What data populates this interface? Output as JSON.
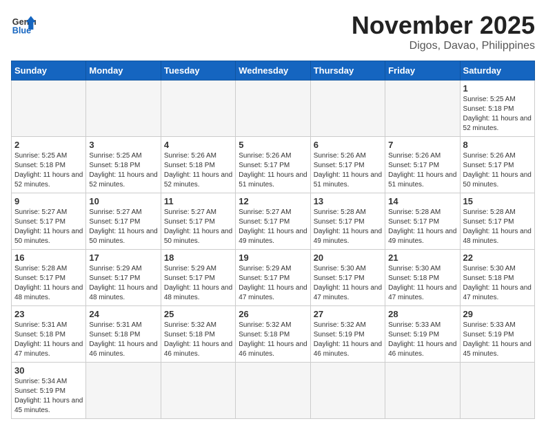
{
  "header": {
    "logo_general": "General",
    "logo_blue": "Blue",
    "title": "November 2025",
    "subtitle": "Digos, Davao, Philippines"
  },
  "weekdays": [
    "Sunday",
    "Monday",
    "Tuesday",
    "Wednesday",
    "Thursday",
    "Friday",
    "Saturday"
  ],
  "days": {
    "1": {
      "sunrise": "5:25 AM",
      "sunset": "5:18 PM",
      "daylight": "11 hours and 52 minutes."
    },
    "2": {
      "sunrise": "5:25 AM",
      "sunset": "5:18 PM",
      "daylight": "11 hours and 52 minutes."
    },
    "3": {
      "sunrise": "5:25 AM",
      "sunset": "5:18 PM",
      "daylight": "11 hours and 52 minutes."
    },
    "4": {
      "sunrise": "5:26 AM",
      "sunset": "5:18 PM",
      "daylight": "11 hours and 52 minutes."
    },
    "5": {
      "sunrise": "5:26 AM",
      "sunset": "5:17 PM",
      "daylight": "11 hours and 51 minutes."
    },
    "6": {
      "sunrise": "5:26 AM",
      "sunset": "5:17 PM",
      "daylight": "11 hours and 51 minutes."
    },
    "7": {
      "sunrise": "5:26 AM",
      "sunset": "5:17 PM",
      "daylight": "11 hours and 51 minutes."
    },
    "8": {
      "sunrise": "5:26 AM",
      "sunset": "5:17 PM",
      "daylight": "11 hours and 50 minutes."
    },
    "9": {
      "sunrise": "5:27 AM",
      "sunset": "5:17 PM",
      "daylight": "11 hours and 50 minutes."
    },
    "10": {
      "sunrise": "5:27 AM",
      "sunset": "5:17 PM",
      "daylight": "11 hours and 50 minutes."
    },
    "11": {
      "sunrise": "5:27 AM",
      "sunset": "5:17 PM",
      "daylight": "11 hours and 50 minutes."
    },
    "12": {
      "sunrise": "5:27 AM",
      "sunset": "5:17 PM",
      "daylight": "11 hours and 49 minutes."
    },
    "13": {
      "sunrise": "5:28 AM",
      "sunset": "5:17 PM",
      "daylight": "11 hours and 49 minutes."
    },
    "14": {
      "sunrise": "5:28 AM",
      "sunset": "5:17 PM",
      "daylight": "11 hours and 49 minutes."
    },
    "15": {
      "sunrise": "5:28 AM",
      "sunset": "5:17 PM",
      "daylight": "11 hours and 48 minutes."
    },
    "16": {
      "sunrise": "5:28 AM",
      "sunset": "5:17 PM",
      "daylight": "11 hours and 48 minutes."
    },
    "17": {
      "sunrise": "5:29 AM",
      "sunset": "5:17 PM",
      "daylight": "11 hours and 48 minutes."
    },
    "18": {
      "sunrise": "5:29 AM",
      "sunset": "5:17 PM",
      "daylight": "11 hours and 48 minutes."
    },
    "19": {
      "sunrise": "5:29 AM",
      "sunset": "5:17 PM",
      "daylight": "11 hours and 47 minutes."
    },
    "20": {
      "sunrise": "5:30 AM",
      "sunset": "5:17 PM",
      "daylight": "11 hours and 47 minutes."
    },
    "21": {
      "sunrise": "5:30 AM",
      "sunset": "5:18 PM",
      "daylight": "11 hours and 47 minutes."
    },
    "22": {
      "sunrise": "5:30 AM",
      "sunset": "5:18 PM",
      "daylight": "11 hours and 47 minutes."
    },
    "23": {
      "sunrise": "5:31 AM",
      "sunset": "5:18 PM",
      "daylight": "11 hours and 47 minutes."
    },
    "24": {
      "sunrise": "5:31 AM",
      "sunset": "5:18 PM",
      "daylight": "11 hours and 46 minutes."
    },
    "25": {
      "sunrise": "5:32 AM",
      "sunset": "5:18 PM",
      "daylight": "11 hours and 46 minutes."
    },
    "26": {
      "sunrise": "5:32 AM",
      "sunset": "5:18 PM",
      "daylight": "11 hours and 46 minutes."
    },
    "27": {
      "sunrise": "5:32 AM",
      "sunset": "5:19 PM",
      "daylight": "11 hours and 46 minutes."
    },
    "28": {
      "sunrise": "5:33 AM",
      "sunset": "5:19 PM",
      "daylight": "11 hours and 46 minutes."
    },
    "29": {
      "sunrise": "5:33 AM",
      "sunset": "5:19 PM",
      "daylight": "11 hours and 45 minutes."
    },
    "30": {
      "sunrise": "5:34 AM",
      "sunset": "5:19 PM",
      "daylight": "11 hours and 45 minutes."
    }
  },
  "labels": {
    "sunrise": "Sunrise:",
    "sunset": "Sunset:",
    "daylight": "Daylight:"
  }
}
